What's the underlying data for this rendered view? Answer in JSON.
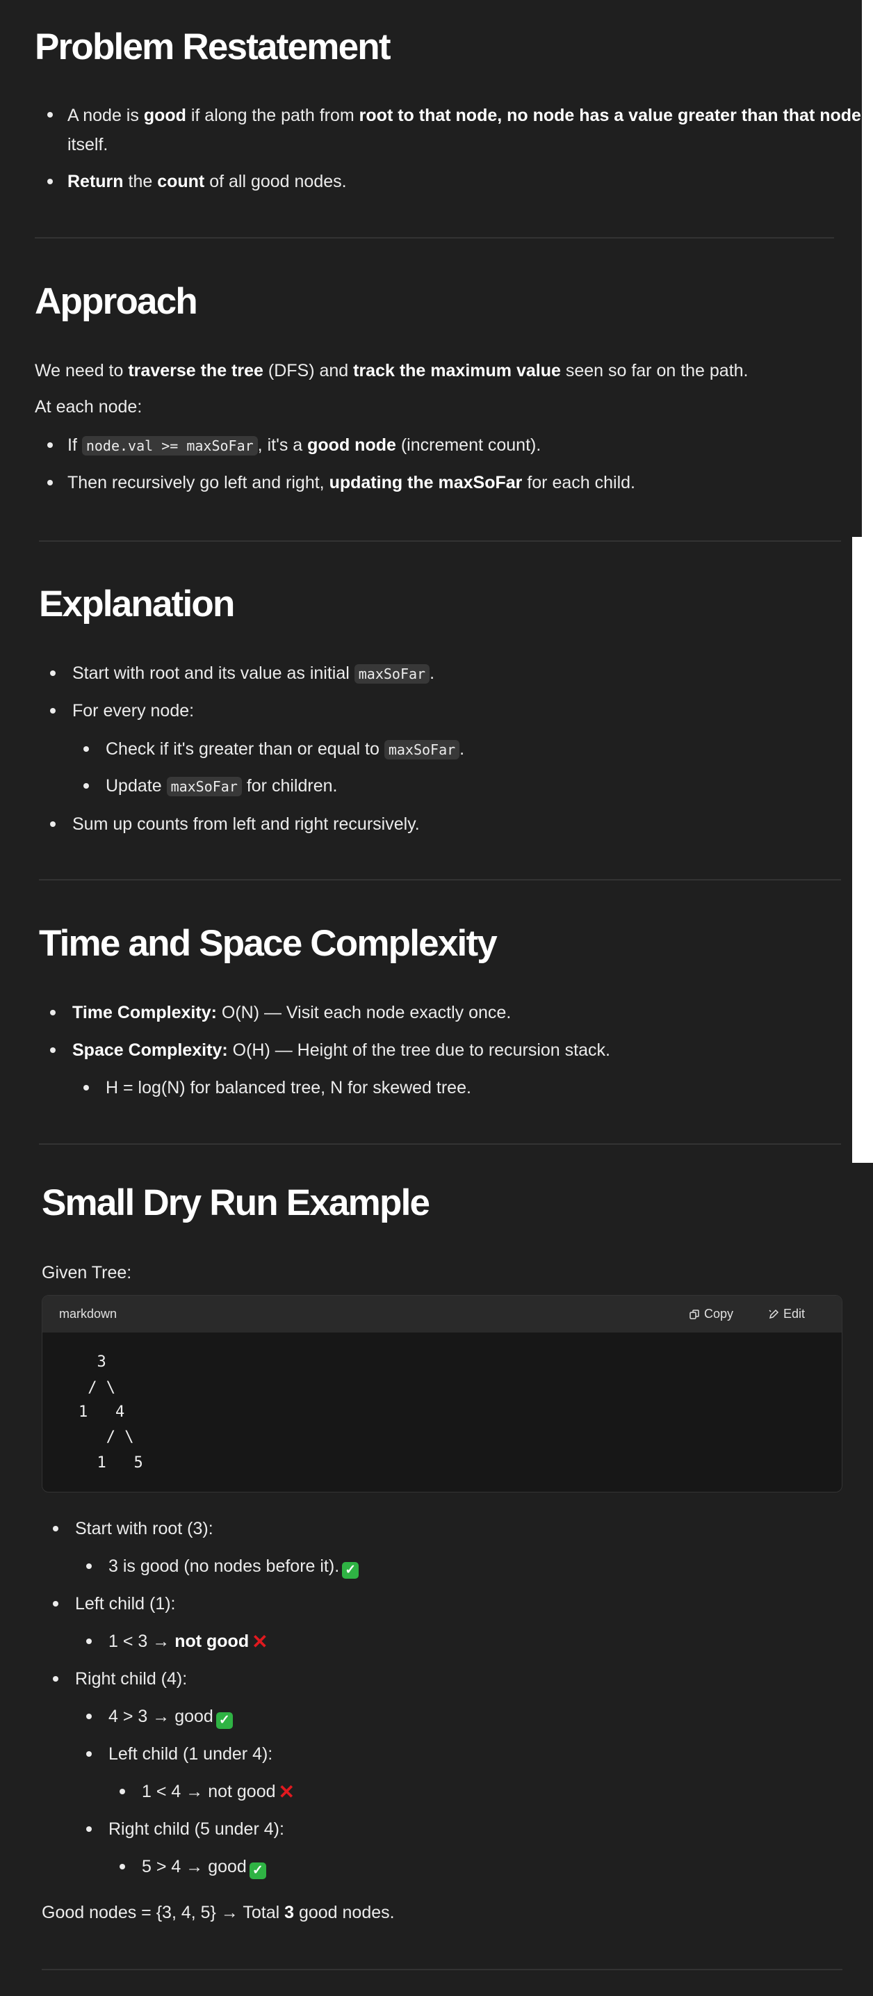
{
  "problem": {
    "title": "Problem Restatement",
    "b1": {
      "a": "A node is ",
      "b": "good",
      "c": " if along the path from ",
      "d": "root to that node, no node has a value greater than that node",
      "e": "itself."
    },
    "b2": {
      "a": "Return",
      "b": " the ",
      "c": "count",
      "d": " of all good nodes."
    }
  },
  "approach": {
    "title": "Approach",
    "p1": {
      "a": "We need to ",
      "b": "traverse the tree",
      "c": " (DFS) and ",
      "d": "track the maximum value",
      "e": " seen so far on the path."
    },
    "p2": "At each node:",
    "b1": {
      "a": "If ",
      "code": "node.val >= maxSoFar",
      "b": ", it's a ",
      "c": "good node",
      "d": " (increment count)."
    },
    "b2": {
      "a": "Then recursively go left and right, ",
      "b": "updating the maxSoFar",
      "c": " for each child."
    }
  },
  "explanation": {
    "title": "Explanation",
    "b1": {
      "a": "Start with root and its value as initial ",
      "code": "maxSoFar",
      "b": "."
    },
    "b2": "For every node:",
    "b2a": {
      "a": "Check if it's greater than or equal to ",
      "code": "maxSoFar",
      "b": "."
    },
    "b2b": {
      "a": "Update ",
      "code": "maxSoFar",
      "b": " for children."
    },
    "b3": "Sum up counts from left and right recursively."
  },
  "complexity": {
    "title": "Time and Space Complexity",
    "b1": {
      "label": "Time Complexity:",
      "text": " O(N) — Visit each node exactly once."
    },
    "b2": {
      "label": "Space Complexity:",
      "text": " O(H) — Height of the tree due to recursion stack."
    },
    "b2a": "H = log(N) for balanced tree, N for skewed tree."
  },
  "dryrun": {
    "title": "Small Dry Run Example",
    "given": "Given Tree:",
    "code": {
      "lang": "markdown",
      "copy": "Copy",
      "edit": "Edit",
      "lines": [
        "  3",
        " / \\",
        "1   4",
        "   / \\",
        "  1   5"
      ]
    },
    "steps": {
      "s1": "Start with root (3):",
      "s1a": "3 is good (no nodes before it).",
      "s2": "Left child (1):",
      "s2a": {
        "a": "1 < 3 → ",
        "b": "not good"
      },
      "s3": "Right child (4):",
      "s3a": "4 > 3 → good",
      "s3b": "Left child (1 under 4):",
      "s3b1": "1 < 4 → not good",
      "s3c": "Right child (5 under 4):",
      "s3c1": "5 > 4 → good"
    },
    "summary": {
      "a": "Good nodes = {3, 4, 5} → Total ",
      "b": "3",
      "c": " good nodes."
    }
  },
  "icons": {
    "good": "check-mark-emoji",
    "bad": "cross-mark-emoji",
    "copy": "copy-icon",
    "edit": "pencil-icon"
  },
  "colors": {
    "background": "#1f1f1f",
    "good": "#2fb344",
    "bad": "#e0191f"
  }
}
